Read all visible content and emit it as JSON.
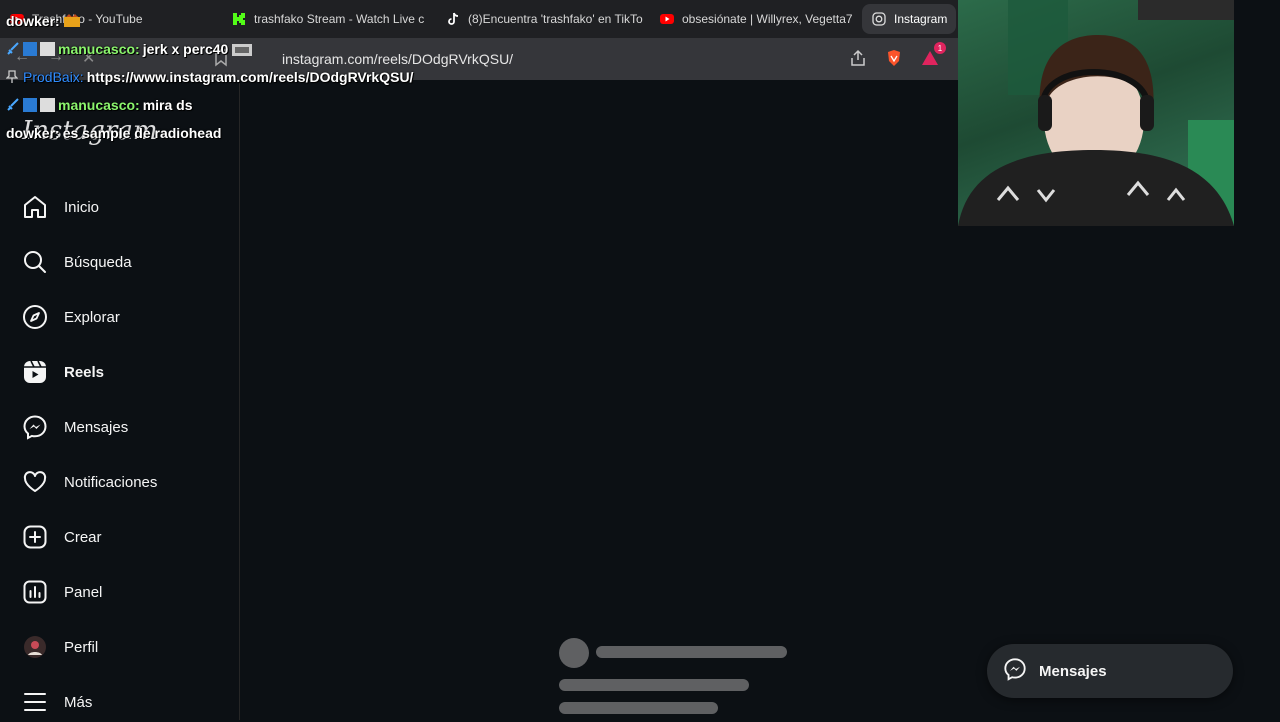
{
  "browser": {
    "tabs": [
      {
        "label": "Trashfako - YouTube",
        "icon": "youtube-icon"
      },
      {
        "label": "trashfako Stream - Watch Live c",
        "icon": "kick-icon"
      },
      {
        "label": "(8)Encuentra 'trashfako' en TikTo",
        "icon": "tiktok-icon"
      },
      {
        "label": "obsesiónate | Willyrex, Vegetta7",
        "icon": "youtube-icon"
      },
      {
        "label": "Instagram",
        "icon": "instagram-icon"
      }
    ],
    "url": "instagram.com/reels/DOdgRVrkQSU/",
    "notification_count": "1"
  },
  "chat": [
    {
      "user": "dowker:",
      "message": ""
    },
    {
      "user": "manucasco:",
      "message": "jerk x perc40"
    },
    {
      "user": "ProdBaix:",
      "message": "https://www.instagram.com/reels/DOdgRVrkQSU/"
    },
    {
      "user": "manucasco:",
      "message": "mira ds"
    },
    {
      "user": "dowker:",
      "message": "es sample de radiohead"
    }
  ],
  "instagram": {
    "brand": "Instagram",
    "nav": [
      {
        "label": "Inicio",
        "icon": "home-icon"
      },
      {
        "label": "Búsqueda",
        "icon": "search-icon"
      },
      {
        "label": "Explorar",
        "icon": "compass-icon"
      },
      {
        "label": "Reels",
        "icon": "reels-icon"
      },
      {
        "label": "Mensajes",
        "icon": "messenger-icon"
      },
      {
        "label": "Notificaciones",
        "icon": "heart-icon"
      },
      {
        "label": "Crear",
        "icon": "plus-square-icon"
      },
      {
        "label": "Panel",
        "icon": "chart-icon"
      },
      {
        "label": "Perfil",
        "icon": "avatar-icon"
      },
      {
        "label": "Más",
        "icon": "menu-icon"
      }
    ],
    "messages_button": "Mensajes"
  },
  "colors": {
    "background": "#0c1014",
    "chat_green": "#8bf56d",
    "chat_blue": "#2f8cff",
    "skeleton": "#5f6062"
  }
}
